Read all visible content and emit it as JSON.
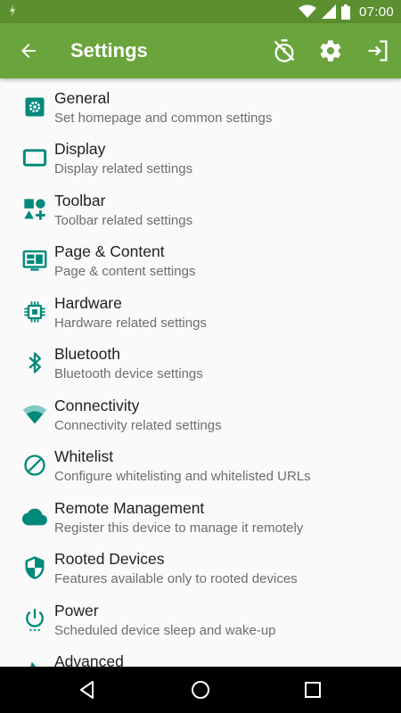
{
  "status_bar": {
    "time": "07:00"
  },
  "app_bar": {
    "title": "Settings",
    "back_icon": "arrow-back-icon",
    "actions": [
      "timer-off-icon",
      "gear-icon",
      "exit-icon"
    ]
  },
  "colors": {
    "primary": "#6aa43c",
    "primary_dark": "#5b8f30",
    "accent": "#00897b"
  },
  "settings": [
    {
      "title": "General",
      "subtitle": "Set homepage and common settings",
      "icon": "general-gear-icon"
    },
    {
      "title": "Display",
      "subtitle": "Display related settings",
      "icon": "display-icon"
    },
    {
      "title": "Toolbar",
      "subtitle": "Toolbar related settings",
      "icon": "toolbar-shapes-icon"
    },
    {
      "title": "Page & Content",
      "subtitle": "Page & content settings",
      "icon": "page-content-icon"
    },
    {
      "title": "Hardware",
      "subtitle": "Hardware related settings",
      "icon": "chip-icon"
    },
    {
      "title": "Bluetooth",
      "subtitle": "Bluetooth device settings",
      "icon": "bluetooth-icon"
    },
    {
      "title": "Connectivity",
      "subtitle": "Connectivity related settings",
      "icon": "wifi-icon"
    },
    {
      "title": "Whitelist",
      "subtitle": "Configure whitelisting and whitelisted URLs",
      "icon": "block-icon"
    },
    {
      "title": "Remote Management",
      "subtitle": "Register this device to manage it remotely",
      "icon": "cloud-icon"
    },
    {
      "title": "Rooted Devices",
      "subtitle": "Features available only to rooted devices",
      "icon": "shield-icon"
    },
    {
      "title": "Power",
      "subtitle": "Scheduled device sleep and wake-up",
      "icon": "power-icon"
    },
    {
      "title": "Advanced",
      "subtitle": "",
      "icon": "advanced-icon"
    }
  ],
  "nav_bar": [
    "back-triangle-icon",
    "home-circle-icon",
    "recents-square-icon"
  ]
}
